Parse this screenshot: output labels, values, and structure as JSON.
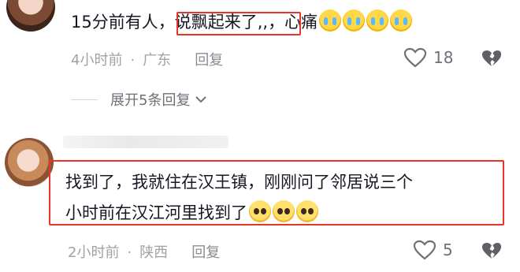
{
  "comment1": {
    "text": "15分前有人，说飘起来了,,，心痛",
    "time": "4小时前",
    "location": "广东",
    "reply_label": "回复",
    "like_count": "18"
  },
  "expand_replies": "展开5条回复",
  "comment2": {
    "line1": "找到了，我就住在汉王镇，刚刚问了邻居说三个",
    "line2": "小时前在汉江河里找到了",
    "time": "2小时前",
    "location": "陕西",
    "reply_label": "回复",
    "like_count": "5"
  },
  "colors": {
    "highlight": "#e8352a",
    "text": "#161823",
    "meta": "#a0a2a8"
  },
  "icons": [
    "heart-outline-icon",
    "broken-heart-icon",
    "chevron-down-icon",
    "crying-emoji-icon",
    "pleading-emoji-icon"
  ]
}
